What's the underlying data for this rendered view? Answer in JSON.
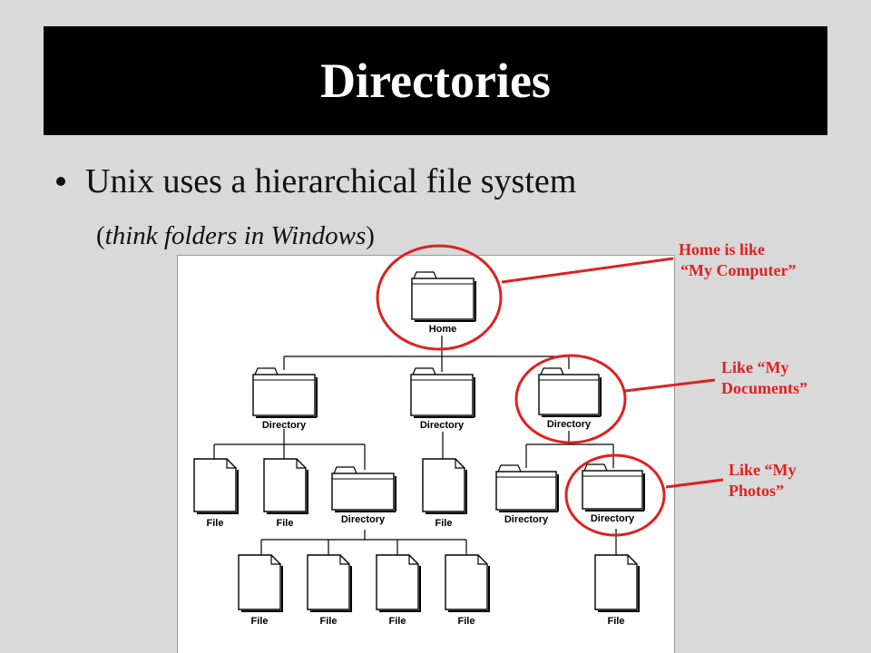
{
  "slide": {
    "title": "Directories",
    "bullet": "Unix uses a hierarchical file system",
    "subnote": {
      "open_paren": "(",
      "italic": "think folders in Windows",
      "close_paren": ")"
    }
  },
  "tree": {
    "root_label": "Home",
    "directory_label": "Directory",
    "file_label": "File"
  },
  "callouts": {
    "home": {
      "line1": "Home is like",
      "line2": "“My Computer”"
    },
    "documents": {
      "line1": "Like “My",
      "line2": "Documents”"
    },
    "photos": {
      "line1": "Like “My",
      "line2": "Photos”"
    }
  },
  "colors": {
    "title_background": "#000000",
    "title_text": "#ffffff",
    "slide_background": "#d9d9d9",
    "callout_red": "#e02020"
  },
  "icons": [
    "folder-icon",
    "file-icon",
    "bullet-dot"
  ]
}
